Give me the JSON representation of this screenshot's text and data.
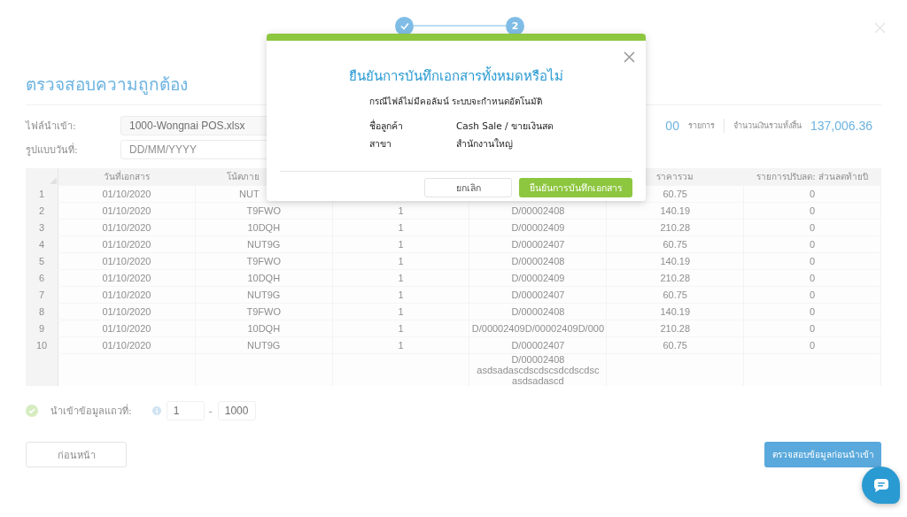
{
  "stepper": [
    {
      "done": true
    },
    {
      "number": "2",
      "done": false
    }
  ],
  "page": {
    "title": "ตรวจสอบความถูกต้อง"
  },
  "form": [
    {
      "label": "ไฟล์นำเข้า:",
      "value": "1000-Wongnai POS.xlsx",
      "kind": "readonly"
    },
    {
      "label": "รูปแบบวันที่:",
      "placeholder": "DD/MM/YYYY",
      "kind": "input"
    }
  ],
  "summary": {
    "count": "00",
    "count_unit": "รายการ",
    "total_label": "จำนวนเงินรวมทั้งสิ้น",
    "total": "137,006.36"
  },
  "table": {
    "columns": [
      "",
      "วันที่เอกสาร",
      "โน้ตภาย",
      "",
      "",
      "ราคารวม",
      "รายการปรับลด: ส่วนลดท้ายบิ"
    ],
    "rows": [
      [
        "1",
        "01/10/2020",
        "NUT",
        null,
        null,
        "60.75",
        "0"
      ],
      [
        "2",
        "01/10/2020",
        "T9FWO",
        "1",
        "D/00002408",
        "140.19",
        "0"
      ],
      [
        "3",
        "01/10/2020",
        "10DQH",
        "1",
        "D/00002409",
        "210.28",
        "0"
      ],
      [
        "4",
        "01/10/2020",
        "NUT9G",
        "1",
        "D/00002407",
        "60.75",
        "0"
      ],
      [
        "5",
        "01/10/2020",
        "T9FWO",
        "1",
        "D/00002408",
        "140.19",
        "0"
      ],
      [
        "6",
        "01/10/2020",
        "10DQH",
        "1",
        "D/00002409",
        "210.28",
        "0"
      ],
      [
        "7",
        "01/10/2020",
        "NUT9G",
        "1",
        "D/00002407",
        "60.75",
        "0"
      ],
      [
        "8",
        "01/10/2020",
        "T9FWO",
        "1",
        "D/00002408",
        "140.19",
        "0"
      ],
      [
        "9",
        "01/10/2020",
        "10DQH",
        "1",
        "D/00002409D/00002409D/000",
        "210.28",
        "0"
      ],
      [
        "10",
        "01/10/2020",
        "NUT9G",
        "1",
        "D/00002407",
        "60.75",
        "0"
      ],
      [
        null,
        null,
        null,
        null,
        "D/00002408 asdsadascdscdscsdcdscdsc asdsadascd",
        null,
        null
      ]
    ]
  },
  "import_range": {
    "checked": true,
    "label": "นำเข้าข้อมูลแถวที่:",
    "from": "1",
    "separator": "-",
    "to": "1000"
  },
  "buttons": {
    "back": "ก่อนหน้า",
    "validate": "ตรวจสอบข้อมูลก่อนนำเข้า"
  },
  "dialog": {
    "title": "ยืนยันการบันทึกเอกสารทั้งหมดหรือไม่",
    "subtitle": "กรณีไฟล์ไม่มีคอลัมน์ ระบบจะกำหนดอัตโนมัติ",
    "fields": [
      {
        "label": "ชื่อลูกค้า",
        "value": "Cash Sale / ขายเงินสด"
      },
      {
        "label": "สาขา",
        "value": "สำนักงานใหญ่"
      }
    ],
    "cancel": "ยกเลิก",
    "confirm": "ยืนยันการบันทึกเอกสาร"
  }
}
